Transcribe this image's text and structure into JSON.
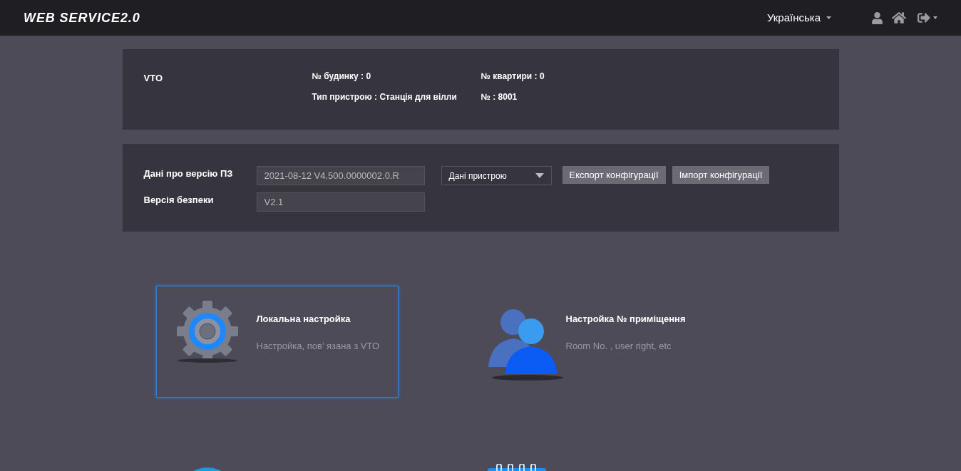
{
  "header": {
    "logo": "WEB SERVICE2.0",
    "language": "Українська"
  },
  "device_info": {
    "name": "VTO",
    "fields": [
      {
        "label": "№ будинку : 0"
      },
      {
        "label": "№ квартири : 0"
      },
      {
        "label": "Тип пристрою : Станція для вілли"
      },
      {
        "label": "№ : 8001"
      }
    ]
  },
  "version_info": {
    "rows": [
      {
        "label": "Дані про версію ПЗ",
        "value": "2021-08-12 V4.500.0000002.0.R"
      },
      {
        "label": "Версія безпеки",
        "value": "V2.1"
      }
    ],
    "dropdown": "Дані пристрою",
    "buttons": [
      "Експорт конфігурації",
      "Імпорт конфігурації"
    ]
  },
  "tiles": [
    {
      "kind": "gear",
      "title": "Локальна настройка",
      "subtitle": "Настройка, пов’ язана з VTO",
      "selected": true
    },
    {
      "kind": "users",
      "title": "Настройка № приміщення",
      "subtitle": "Room No. , user right, etc",
      "selected": false
    },
    {
      "kind": "globe",
      "selected": false
    },
    {
      "kind": "notebook",
      "selected": false
    }
  ]
}
